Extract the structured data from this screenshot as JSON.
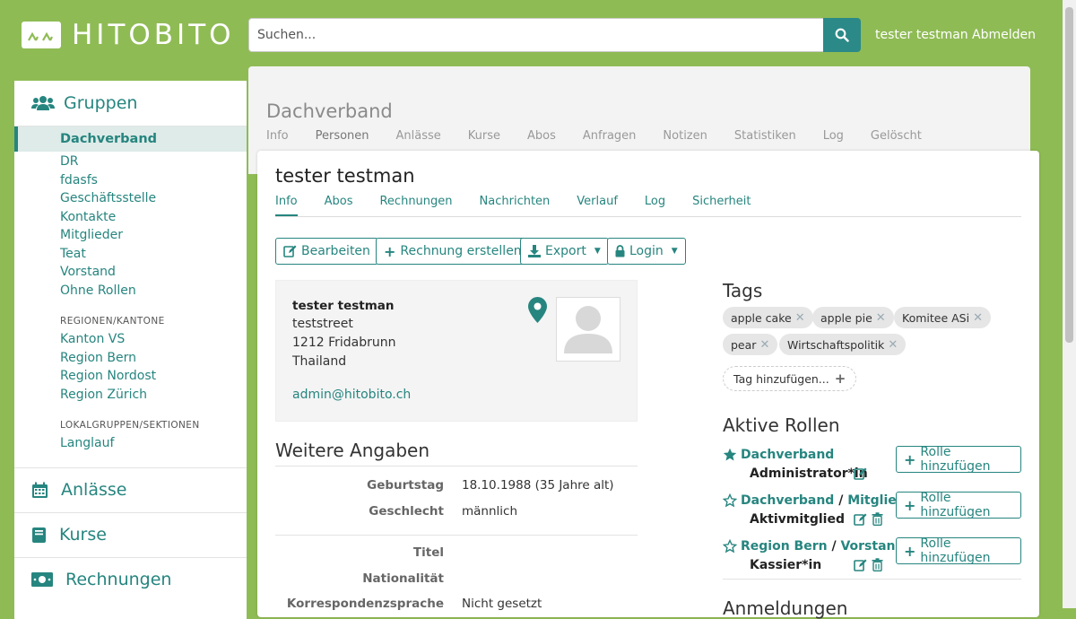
{
  "header": {
    "logo_text": "HITOBITO",
    "search_placeholder": "Suchen...",
    "user": "tester testman",
    "logout": "Abmelden"
  },
  "sidebar": {
    "groups_title": "Gruppen",
    "active_group": "Dachverband",
    "items": [
      "DR",
      "fdasfs",
      "Geschäftsstelle",
      "Kontakte",
      "Mitglieder",
      "Teat",
      "Vorstand",
      "Ohne Rollen"
    ],
    "regions_label": "REGIONEN/KANTONE",
    "regions": [
      "Kanton VS",
      "Region Bern",
      "Region Nordost",
      "Region Zürich"
    ],
    "local_label": "LOKALGRUPPEN/SEKTIONEN",
    "local": [
      "Langlauf"
    ],
    "sections": [
      "Anlässe",
      "Kurse",
      "Rechnungen"
    ]
  },
  "group": {
    "title": "Dachverband",
    "tabs": [
      "Info",
      "Personen",
      "Anlässe",
      "Kurse",
      "Abos",
      "Anfragen",
      "Notizen",
      "Statistiken",
      "Log",
      "Gelöscht"
    ]
  },
  "person": {
    "title": "tester testman",
    "tabs": [
      "Info",
      "Abos",
      "Rechnungen",
      "Nachrichten",
      "Verlauf",
      "Log",
      "Sicherheit"
    ],
    "actions": {
      "edit": "Bearbeiten",
      "invoice": "Rechnung erstellen",
      "export": "Export",
      "login": "Login"
    },
    "address": {
      "name": "tester testman",
      "street": "teststreet",
      "city": "1212 Fridabrunn",
      "country": "Thailand",
      "email": "admin@hitobito.ch"
    },
    "details": {
      "title": "Weitere Angaben",
      "rows": [
        {
          "label": "Geburtstag",
          "value": "18.10.1988 (35 Jahre alt)"
        },
        {
          "label": "Geschlecht",
          "value": "männlich"
        },
        {
          "label": "Titel",
          "value": ""
        },
        {
          "label": "Nationalität",
          "value": ""
        },
        {
          "label": "Korrespondenzsprache",
          "value": "Nicht gesetzt"
        }
      ]
    },
    "tags": {
      "title": "Tags",
      "items": [
        "apple cake",
        "apple pie",
        "Komitee ASi",
        "pear",
        "Wirtschaftspolitik"
      ],
      "add_label": "Tag hinzufügen..."
    },
    "roles": {
      "title": "Aktive Rollen",
      "add_label": "Rolle hinzufügen",
      "items": [
        {
          "group": "Dachverband",
          "subgroup": "",
          "role": "Administrator*in"
        },
        {
          "group": "Dachverband",
          "subgroup": "Mitglieder",
          "role": "Aktivmitglied"
        },
        {
          "group": "Region Bern",
          "subgroup": "Vorstand",
          "role": "Kassier*in"
        }
      ]
    },
    "cut_off_title": "Anmeldungen"
  },
  "colors": {
    "background": "#8fbb55",
    "accent": "#26857f"
  }
}
